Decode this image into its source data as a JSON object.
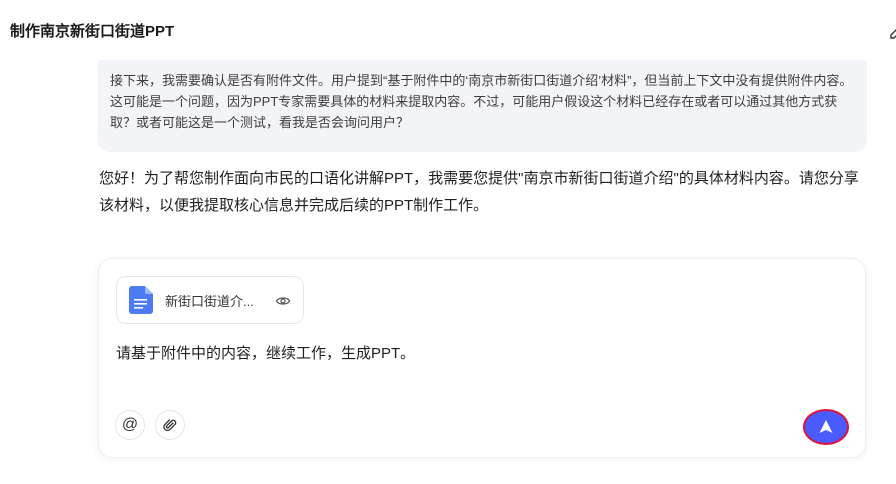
{
  "header": {
    "title": "制作南京新街口街道PPT"
  },
  "thinking": {
    "text": "接下来，我需要确认是否有附件文件。用户提到“基于附件中的‘南京市新街口街道介绍’材料”，但当前上下文中没有提供附件内容。这可能是一个问题，因为PPT专家需要具体的材料来提取内容。不过，可能用户假设这个材料已经存在或者可以通过其他方式获取？或者可能这是一个测试，看我是否会询问用户？"
  },
  "answer": {
    "text": "您好！为了帮您制作面向市民的口语化讲解PPT，我需要您提供\"南京市新街口街道介绍\"的具体材料内容。请您分享该材料，以便我提取核心信息并完成后续的PPT制作工作。"
  },
  "composer": {
    "attachment_name": "新街口街道介...",
    "prompt": "请基于附件中的内容，继续工作，生成PPT。",
    "mention_icon": "at-icon",
    "attach_icon": "paperclip-icon",
    "send_icon": "send-arrow-icon"
  },
  "colors": {
    "send_button": "#4a5bff",
    "send_outline": "#e0123a",
    "thinking_bg": "#f3f4f7",
    "doc_icon": "#4c7bf3"
  }
}
